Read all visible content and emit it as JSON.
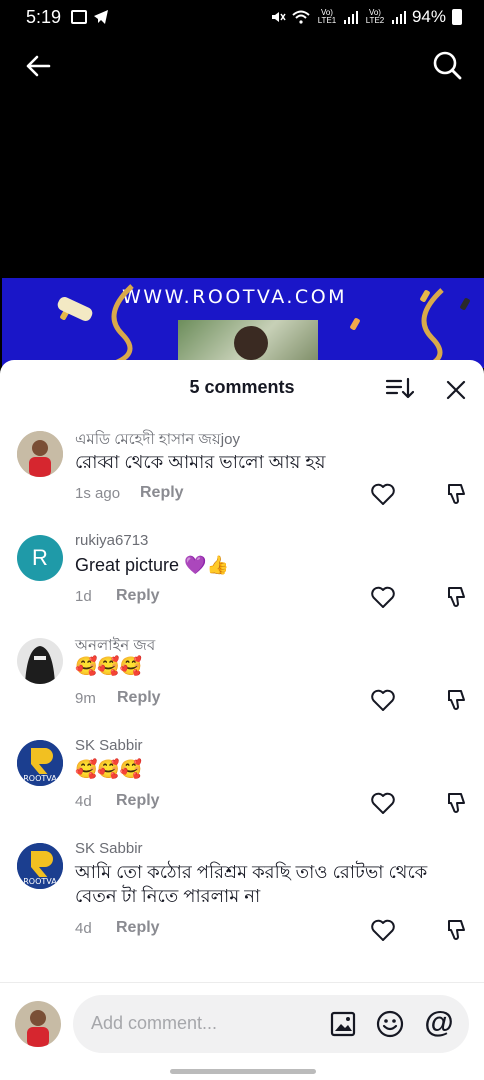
{
  "status_bar": {
    "time": "5:19",
    "battery": "94%",
    "lte1": "Vo) LTE1",
    "lte2": "Vo) LTE2"
  },
  "banner": {
    "text": "WWW.ROOTVA.COM"
  },
  "comments_header": {
    "title": "5 comments"
  },
  "comments": [
    {
      "username": "এমডি মেহেদী হাসান জয়joy",
      "text": "রোব্বা থেকে আমার ভালো আয় হয়",
      "time": "1s ago",
      "reply": "Reply",
      "avatar_type": "photo"
    },
    {
      "username": "rukiya6713",
      "text": "Great picture 💜👍",
      "time": "1d",
      "reply": "Reply",
      "avatar_type": "letter",
      "avatar_letter": "R"
    },
    {
      "username": "অনলাইন জব",
      "text": "🥰🥰🥰",
      "time": "9m",
      "reply": "Reply",
      "avatar_type": "photo"
    },
    {
      "username": "SK Sabbir",
      "text": "🥰🥰🥰",
      "time": "4d",
      "reply": "Reply",
      "avatar_type": "logo"
    },
    {
      "username": "SK Sabbir",
      "text": "আমি তো কঠোর পরিশ্রম করছি তাও রোটভা থেকে বেতন টা নিতে পারলাম না",
      "time": "4d",
      "reply": "Reply",
      "avatar_type": "logo"
    }
  ],
  "composer": {
    "placeholder": "Add comment..."
  },
  "icons": [
    "back-arrow-icon",
    "search-icon",
    "sort-icon",
    "close-icon",
    "heart-icon",
    "dislike-icon",
    "image-icon",
    "emoji-icon",
    "mention-icon"
  ],
  "colors": {
    "accent_avatar": "#1f9aa8",
    "banner_bg": "#1a16c8"
  }
}
